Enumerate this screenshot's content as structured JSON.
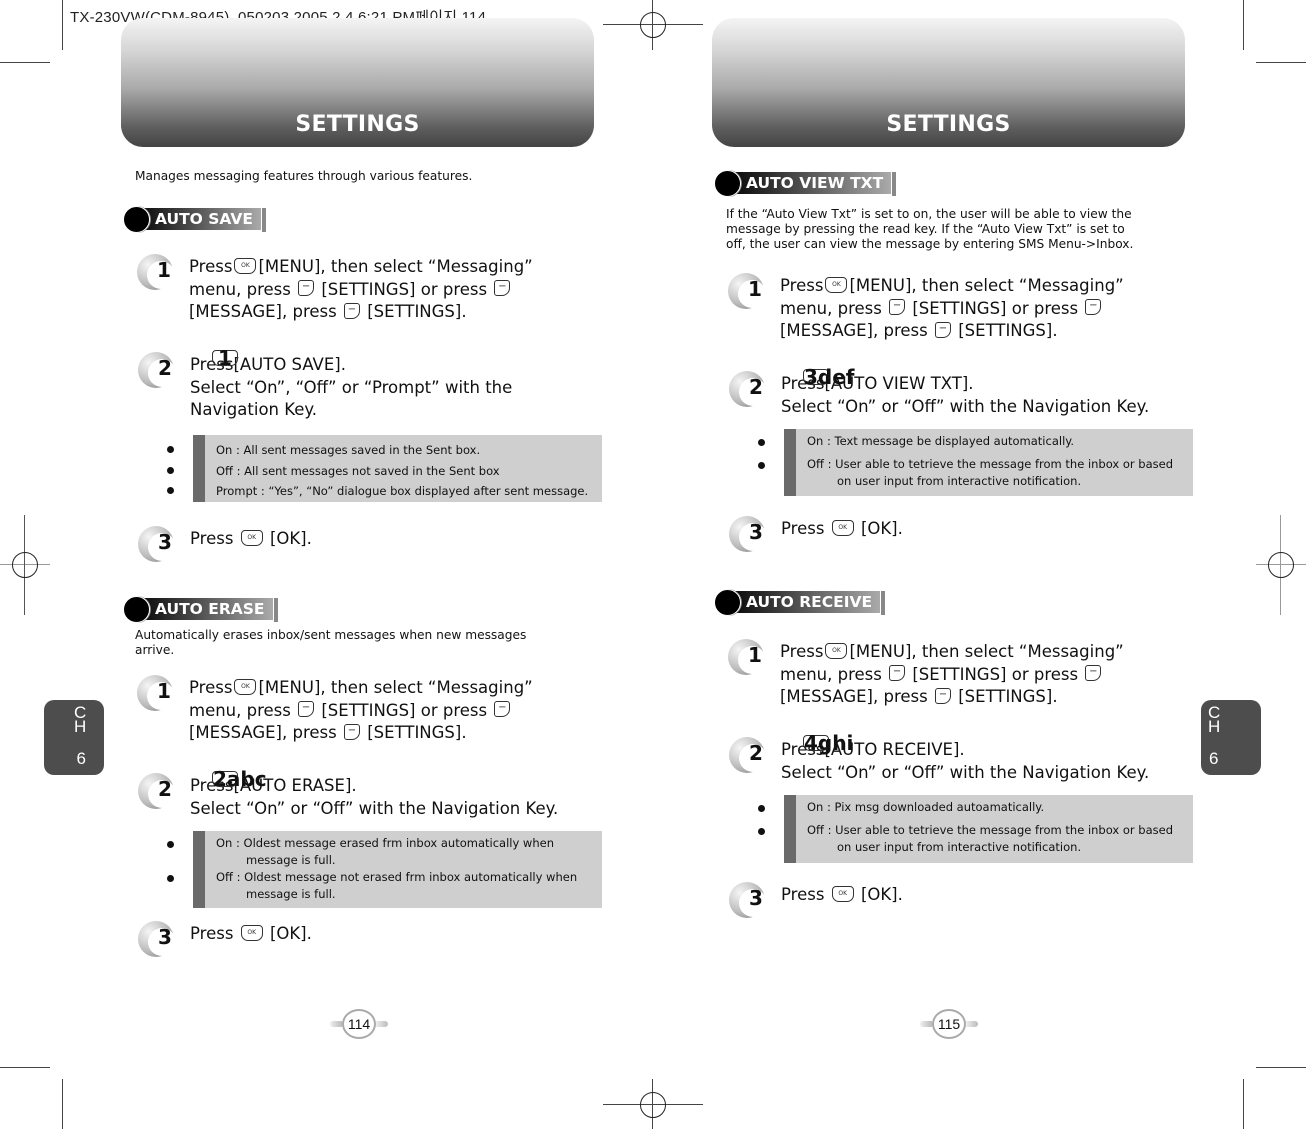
{
  "slug": "TX-230VW(CDM-8945)_050203  2005.2.4 6:21 PM페이지 114",
  "left_page": {
    "header_title": "SETTINGS",
    "intro": "Manages messaging features through various features.",
    "chapter_tab": {
      "line1": "C",
      "line2": "H",
      "number": "6"
    },
    "page_number": "114",
    "sections": [
      {
        "title": "AUTO SAVE",
        "description": "",
        "steps": [
          {
            "number": "1",
            "line1_pre": "Press",
            "key1": "OK",
            "line1_post": "[MENU], then select “Messaging”",
            "line2_pre": "menu, press",
            "line2_mid": "[SETTINGS] or press",
            "line3_pre": "[MESSAGE], press",
            "line3_post": "[SETTINGS]."
          },
          {
            "number": "2",
            "pre": "Press",
            "key": "1",
            "post": "[AUTO SAVE].",
            "line2": "Select “On”, “Off” or “Prompt” with the",
            "line3": "Navigation Key."
          },
          {
            "number": "3",
            "pre": "Press",
            "key": "OK",
            "post": "[OK]."
          }
        ],
        "notes": [
          {
            "text": "On : All sent messages saved in the Sent box.",
            "cont": ""
          },
          {
            "text": "Off : All sent messages not saved in the Sent box",
            "cont": ""
          },
          {
            "text": "Prompt : “Yes”, “No” dialogue box displayed after sent message.",
            "cont": ""
          }
        ]
      },
      {
        "title": "AUTO ERASE",
        "description": "Automatically erases inbox/sent messages when new messages arrive.",
        "steps": [
          {
            "number": "1",
            "line1_pre": "Press",
            "key1": "OK",
            "line1_post": "[MENU], then select “Messaging”",
            "line2_pre": "menu, press",
            "line2_mid": "[SETTINGS] or press",
            "line3_pre": "[MESSAGE], press",
            "line3_post": "[SETTINGS]."
          },
          {
            "number": "2",
            "pre": "Press",
            "key": "2abc",
            "post": "[AUTO ERASE].",
            "line2": "Select “On” or “Off” with the Navigation Key.",
            "line3": ""
          },
          {
            "number": "3",
            "pre": "Press",
            "key": "OK",
            "post": "[OK]."
          }
        ],
        "notes": [
          {
            "text": "On : Oldest message erased frm inbox automatically when",
            "cont": "message is full."
          },
          {
            "text": "Off : Oldest message not erased frm inbox automatically when",
            "cont": "message is full."
          }
        ]
      }
    ]
  },
  "right_page": {
    "header_title": "SETTINGS",
    "chapter_tab": {
      "line1": "C",
      "line2": "H",
      "number": "6"
    },
    "page_number": "115",
    "sections": [
      {
        "title": "AUTO VIEW TXT",
        "description_lines": [
          "If the “Auto View Txt” is set to on, the user will be able to view the",
          "message by pressing the read key. If the “Auto View Txt” is set to",
          "off, the user can view the message by entering SMS Menu->Inbox."
        ],
        "steps": [
          {
            "number": "1",
            "line1_pre": "Press",
            "key1": "OK",
            "line1_post": "[MENU], then select “Messaging”",
            "line2_pre": "menu, press",
            "line2_mid": "[SETTINGS] or press",
            "line3_pre": "[MESSAGE], press",
            "line3_post": "[SETTINGS]."
          },
          {
            "number": "2",
            "pre": "Press",
            "key": "3def",
            "post": "[AUTO VIEW TXT].",
            "line2": "Select “On” or “Off” with the Navigation Key.",
            "line3": ""
          },
          {
            "number": "3",
            "pre": "Press",
            "key": "OK",
            "post": "[OK]."
          }
        ],
        "notes": [
          {
            "text": "On : Text message be displayed automatically.",
            "cont": ""
          },
          {
            "text": "Off : User able to tetrieve the message from the inbox or based",
            "cont": "on user input from interactive notification."
          }
        ]
      },
      {
        "title": "AUTO RECEIVE",
        "steps": [
          {
            "number": "1",
            "line1_pre": "Press",
            "key1": "OK",
            "line1_post": "[MENU], then select “Messaging”",
            "line2_pre": "menu, press",
            "line2_mid": "[SETTINGS] or press",
            "line3_pre": "[MESSAGE], press",
            "line3_post": "[SETTINGS]."
          },
          {
            "number": "2",
            "pre": "Press",
            "key": "4ghi",
            "post": "[AUTO RECEIVE].",
            "line2": "Select “On” or “Off” with the Navigation Key.",
            "line3": ""
          },
          {
            "number": "3",
            "pre": "Press",
            "key": "OK",
            "post": "[OK]."
          }
        ],
        "notes": [
          {
            "text": "On : Pix msg downloaded autoamatically.",
            "cont": ""
          },
          {
            "text": "Off : User able to tetrieve the message from the inbox or based",
            "cont": "on user input from interactive notification."
          }
        ]
      }
    ]
  },
  "icons": {
    "soft_key": "−",
    "ok_key": "OK"
  }
}
